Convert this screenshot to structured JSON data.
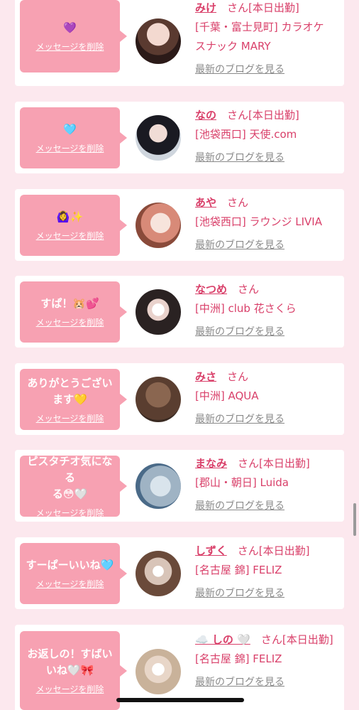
{
  "delete_label": "メッセージを削除",
  "blog_label": "最新のブログを見る",
  "san_label": "さん",
  "items": [
    {
      "message": "💜",
      "name": "みけ",
      "status": "[本日出勤]",
      "shop_lines": [
        "[千葉・富士見町] カラオケ",
        "スナック MARY"
      ]
    },
    {
      "message": "🩵",
      "name": "なの",
      "status": "[本日出勤]",
      "shop_lines": [
        "[池袋西口] 天使.com"
      ]
    },
    {
      "message": "🙆‍♀️✨",
      "name": "あや",
      "status": "",
      "shop_lines": [
        "[池袋西口] ラウンジ LIVIA"
      ]
    },
    {
      "message": "すぱ！🐹💕",
      "name": "なつめ",
      "status": "",
      "shop_lines": [
        "[中洲] club 花さくら"
      ]
    },
    {
      "message": "ありがとうござい\nます💛",
      "name": "みさ",
      "status": "",
      "shop_lines": [
        "[中洲] AQUA"
      ]
    },
    {
      "message": "ピスタチオ気になる\nる😳🤍",
      "name": "まなみ",
      "status": "[本日出勤]",
      "shop_lines": [
        "[郡山・朝日] Luida"
      ]
    },
    {
      "message": "すーぱーいいね🩵",
      "name": "しずく",
      "status": "[本日出勤]",
      "shop_lines": [
        "[名古屋 錦] FELIZ"
      ]
    },
    {
      "message": "お返しの！すばい\nいね🤍🎀",
      "name": "☁️ しの 🤍",
      "status": "[本日出勤]",
      "shop_lines": [
        "[名古屋 錦] FELIZ"
      ]
    }
  ]
}
